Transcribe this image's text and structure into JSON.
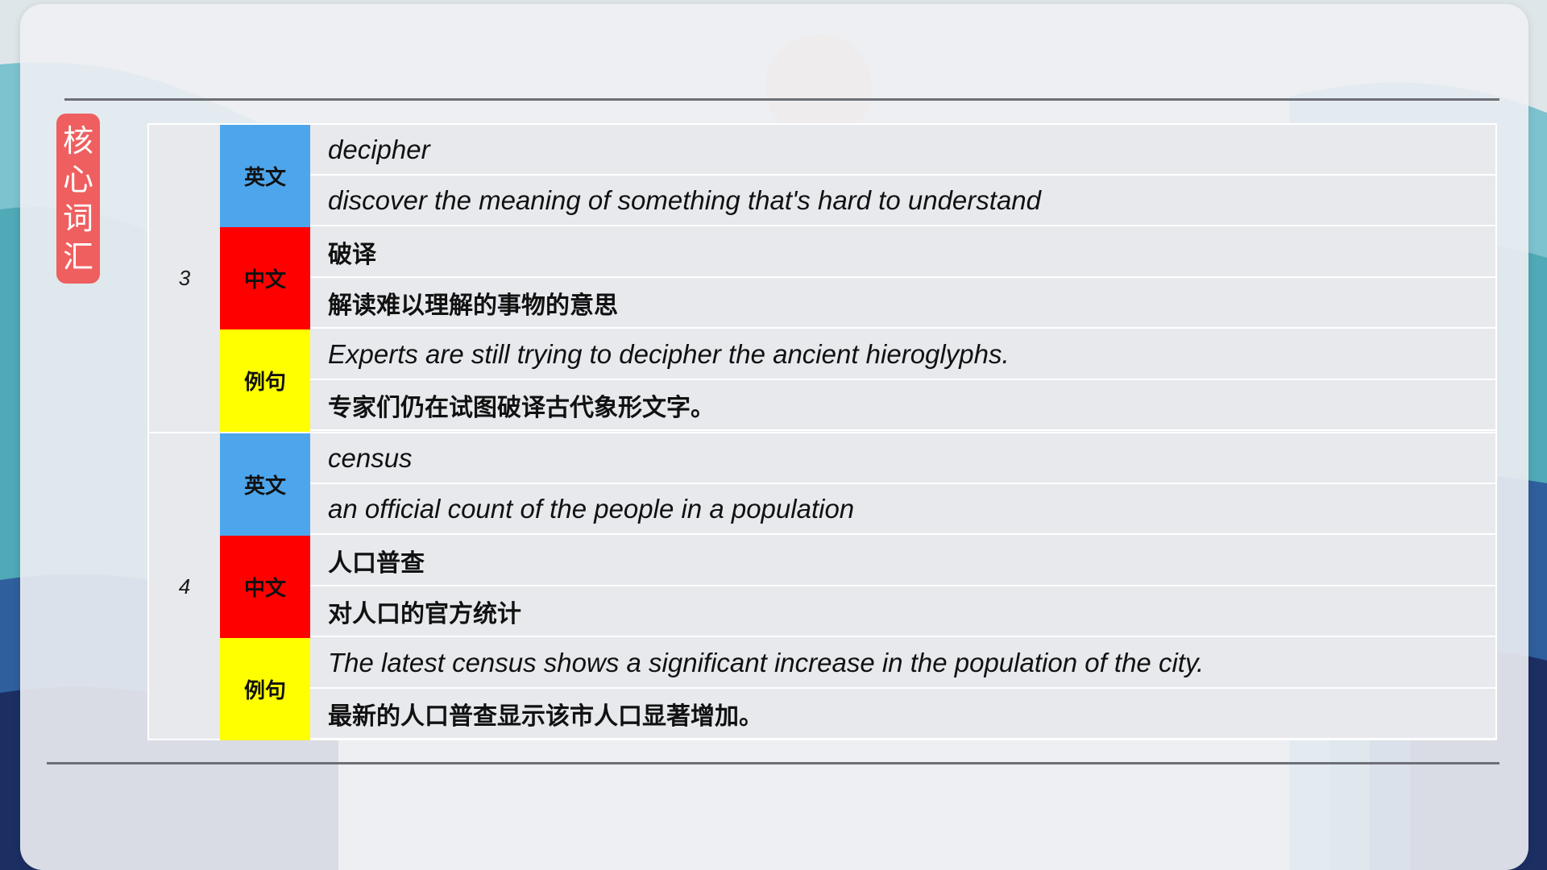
{
  "side_label": [
    "核",
    "心",
    "词",
    "汇"
  ],
  "entries": [
    {
      "index": "3",
      "rows": [
        {
          "label": "英文",
          "lines": [
            "decipher",
            "discover the meaning of something that's hard to understand"
          ]
        },
        {
          "label": "中文",
          "lines": [
            "破译",
            "解读难以理解的事物的意思"
          ]
        },
        {
          "label": "例句",
          "lines": [
            "Experts are still trying to decipher the ancient hieroglyphs.",
            "专家们仍在试图破译古代象形文字。"
          ]
        }
      ]
    },
    {
      "index": "4",
      "rows": [
        {
          "label": "英文",
          "lines": [
            "census",
            "an official count of the people in a population"
          ]
        },
        {
          "label": "中文",
          "lines": [
            "人口普查",
            "对人口的官方统计"
          ]
        },
        {
          "label": "例句",
          "lines": [
            "The latest census shows a significant increase in the population of the city.",
            "最新的人口普查显示该市人口显著增加。"
          ]
        }
      ]
    }
  ],
  "colors": {
    "english_label": "#4da6ec",
    "chinese_label": "#ff0000",
    "example_label": "#ffff00",
    "side_tag": "#ef5f5f"
  }
}
